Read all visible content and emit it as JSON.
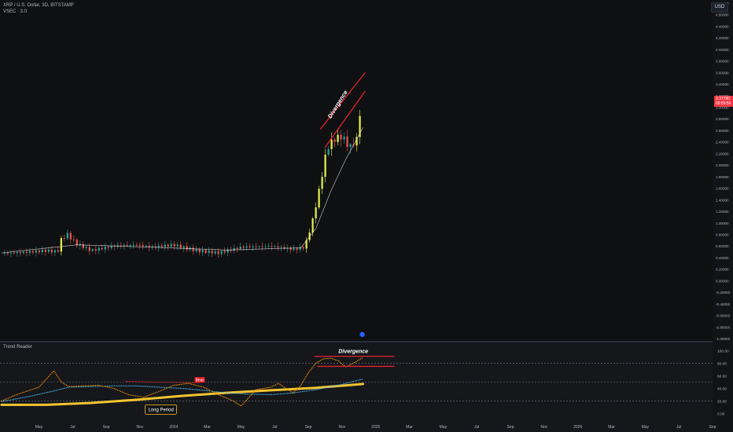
{
  "header": {
    "symbol_line": "XRP / U.S. Dollar, 3D, BITSTAMP",
    "indicator_line": "VSEC · 3.0",
    "currency_button": "USD"
  },
  "price_tag": {
    "value": "3.37780",
    "countdown": "09:59:56"
  },
  "colors": {
    "background": "#0f1012",
    "bull_candle": "#26a69a",
    "bear_candle": "#ef5350",
    "highlight_candle": "#e6f54a",
    "divergence_line": "#e2232e",
    "rsi_line": "#ff9800",
    "signal_line": "#4fc3f7",
    "long_period_line": "#f4c430"
  },
  "annotations": {
    "main_divergence": "Divergence",
    "lower_divergence": "Divergence",
    "bear_label": "Bear",
    "long_period": "Long Period"
  },
  "chart_data": [
    {
      "type": "candlestick",
      "title": "XRP / U.S. Dollar, 3D, BITSTAMP",
      "ylim": [
        -1.0,
        4.8
      ],
      "y_ticks": [
        "4.80000",
        "4.60000",
        "4.40000",
        "4.20000",
        "4.00000",
        "3.80000",
        "3.60000",
        "3.40000",
        "3.20000",
        "3.00000",
        "2.80000",
        "2.60000",
        "2.40000",
        "2.20000",
        "2.00000",
        "1.80000",
        "1.60000",
        "1.40000",
        "1.20000",
        "1.00000",
        "0.80000",
        "0.60000",
        "0.40000",
        "0.20000",
        "0.00000",
        "-0.20000",
        "-0.40000",
        "-0.60000",
        "-0.80000",
        "-1.00000"
      ],
      "x_ticks": [
        "May",
        "Jul",
        "Sep",
        "Nov",
        "2024",
        "Mar",
        "May",
        "Jul",
        "Sep",
        "Nov",
        "2025",
        "Mar",
        "May",
        "Jul",
        "Sep",
        "Nov",
        "2026",
        "Mar",
        "May",
        "Jul",
        "Sep"
      ],
      "price_path": [
        {
          "x": 0.0,
          "y": 0.47
        },
        {
          "x": 3.0,
          "y": 0.49
        },
        {
          "x": 6.0,
          "y": 0.52
        },
        {
          "x": 7.5,
          "y": 0.5
        },
        {
          "x": 8.0,
          "y": 0.72
        },
        {
          "x": 8.8,
          "y": 0.8
        },
        {
          "x": 10.0,
          "y": 0.64
        },
        {
          "x": 12.0,
          "y": 0.52
        },
        {
          "x": 15.0,
          "y": 0.6
        },
        {
          "x": 18.0,
          "y": 0.62
        },
        {
          "x": 20.0,
          "y": 0.58
        },
        {
          "x": 23.0,
          "y": 0.62
        },
        {
          "x": 26.0,
          "y": 0.52
        },
        {
          "x": 29.0,
          "y": 0.48
        },
        {
          "x": 32.0,
          "y": 0.58
        },
        {
          "x": 36.0,
          "y": 0.6
        },
        {
          "x": 39.0,
          "y": 0.54
        },
        {
          "x": 40.5,
          "y": 0.58
        },
        {
          "x": 41.5,
          "y": 1.0
        },
        {
          "x": 42.5,
          "y": 1.6
        },
        {
          "x": 43.5,
          "y": 2.3
        },
        {
          "x": 44.5,
          "y": 2.45
        },
        {
          "x": 45.5,
          "y": 2.5
        },
        {
          "x": 46.5,
          "y": 2.3
        },
        {
          "x": 47.5,
          "y": 2.45
        },
        {
          "x": 48.3,
          "y": 3.38
        }
      ],
      "moving_average": [
        {
          "x": 0.0,
          "y": 0.48
        },
        {
          "x": 10.0,
          "y": 0.62
        },
        {
          "x": 20.0,
          "y": 0.58
        },
        {
          "x": 30.0,
          "y": 0.53
        },
        {
          "x": 40.0,
          "y": 0.57
        },
        {
          "x": 42.0,
          "y": 0.9
        },
        {
          "x": 44.0,
          "y": 1.55
        },
        {
          "x": 46.0,
          "y": 2.1
        },
        {
          "x": 48.3,
          "y": 2.65
        }
      ]
    },
    {
      "type": "line",
      "title": "Trend Reader",
      "ylim": [
        -8,
        108
      ],
      "y_ticks": [
        "100.00",
        "80.00",
        "60.00",
        "40.00",
        "20.00",
        "0.00"
      ],
      "reference_lines": [
        80,
        50,
        20
      ],
      "series": [
        {
          "values_xy": [
            {
              "x": 0,
              "y": 20
            },
            {
              "x": 2,
              "y": 30
            },
            {
              "x": 4,
              "y": 38
            },
            {
              "x": 5,
              "y": 42
            },
            {
              "x": 6,
              "y": 55
            },
            {
              "x": 7,
              "y": 68
            },
            {
              "x": 8,
              "y": 50
            },
            {
              "x": 9,
              "y": 43
            },
            {
              "x": 11,
              "y": 44
            },
            {
              "x": 13,
              "y": 45
            },
            {
              "x": 15,
              "y": 40
            },
            {
              "x": 17,
              "y": 30
            },
            {
              "x": 19,
              "y": 26
            },
            {
              "x": 21,
              "y": 35
            },
            {
              "x": 23,
              "y": 45
            },
            {
              "x": 25,
              "y": 48
            },
            {
              "x": 27,
              "y": 42
            },
            {
              "x": 29,
              "y": 30
            },
            {
              "x": 31,
              "y": 20
            },
            {
              "x": 32,
              "y": 12
            },
            {
              "x": 33,
              "y": 25
            },
            {
              "x": 34,
              "y": 38
            },
            {
              "x": 36,
              "y": 42
            },
            {
              "x": 37,
              "y": 48
            },
            {
              "x": 38,
              "y": 40
            },
            {
              "x": 39,
              "y": 33
            },
            {
              "x": 40,
              "y": 45
            },
            {
              "x": 41,
              "y": 65
            },
            {
              "x": 42,
              "y": 80
            },
            {
              "x": 43,
              "y": 87
            },
            {
              "x": 44,
              "y": 88
            },
            {
              "x": 45,
              "y": 84
            },
            {
              "x": 46,
              "y": 74
            },
            {
              "x": 47,
              "y": 80
            },
            {
              "x": 48.3,
              "y": 89
            }
          ]
        },
        {
          "values_xy": [
            {
              "x": 0,
              "y": 19
            },
            {
              "x": 4,
              "y": 28
            },
            {
              "x": 7,
              "y": 36
            },
            {
              "x": 9,
              "y": 42
            },
            {
              "x": 12,
              "y": 43
            },
            {
              "x": 15,
              "y": 44
            },
            {
              "x": 18,
              "y": 44
            },
            {
              "x": 21,
              "y": 42
            },
            {
              "x": 24,
              "y": 40
            },
            {
              "x": 27,
              "y": 37
            },
            {
              "x": 30,
              "y": 33
            },
            {
              "x": 33,
              "y": 31
            },
            {
              "x": 36,
              "y": 30
            },
            {
              "x": 39,
              "y": 33
            },
            {
              "x": 42,
              "y": 38
            },
            {
              "x": 45,
              "y": 45
            },
            {
              "x": 48.3,
              "y": 55
            }
          ]
        },
        {
          "values_xy": [
            {
              "x": 0,
              "y": 14
            },
            {
              "x": 6,
              "y": 14
            },
            {
              "x": 12,
              "y": 17
            },
            {
              "x": 18,
              "y": 22
            },
            {
              "x": 24,
              "y": 28
            },
            {
              "x": 30,
              "y": 33
            },
            {
              "x": 36,
              "y": 37
            },
            {
              "x": 42,
              "y": 41
            },
            {
              "x": 48.3,
              "y": 47
            }
          ]
        }
      ]
    }
  ]
}
